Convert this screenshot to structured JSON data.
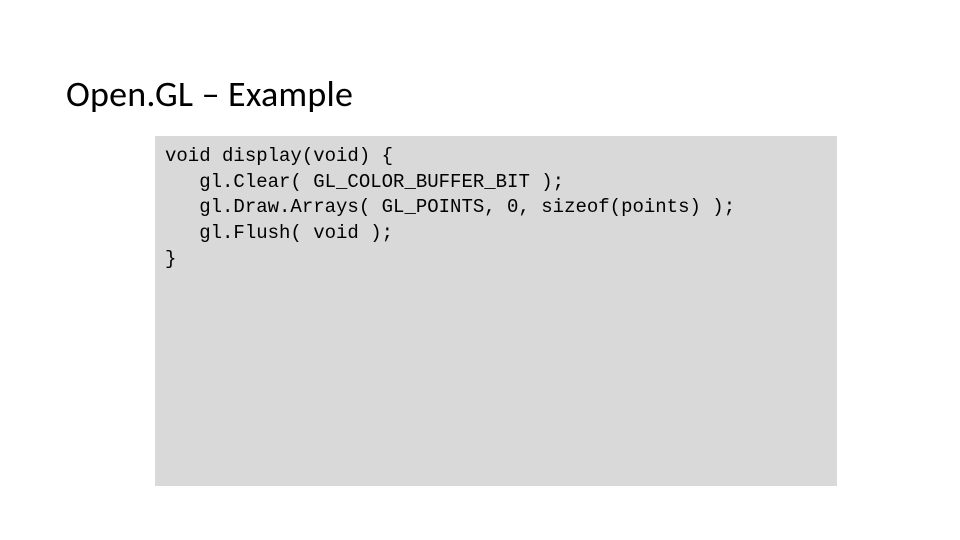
{
  "slide": {
    "title": "Open.GL – Example",
    "code": {
      "line1": "void display(void) {",
      "line2": "   gl.Clear( GL_COLOR_BUFFER_BIT );",
      "line3": "   gl.Draw.Arrays( GL_POINTS, 0, sizeof(points) );",
      "line4": "   gl.Flush( void );",
      "line5": "}"
    }
  }
}
